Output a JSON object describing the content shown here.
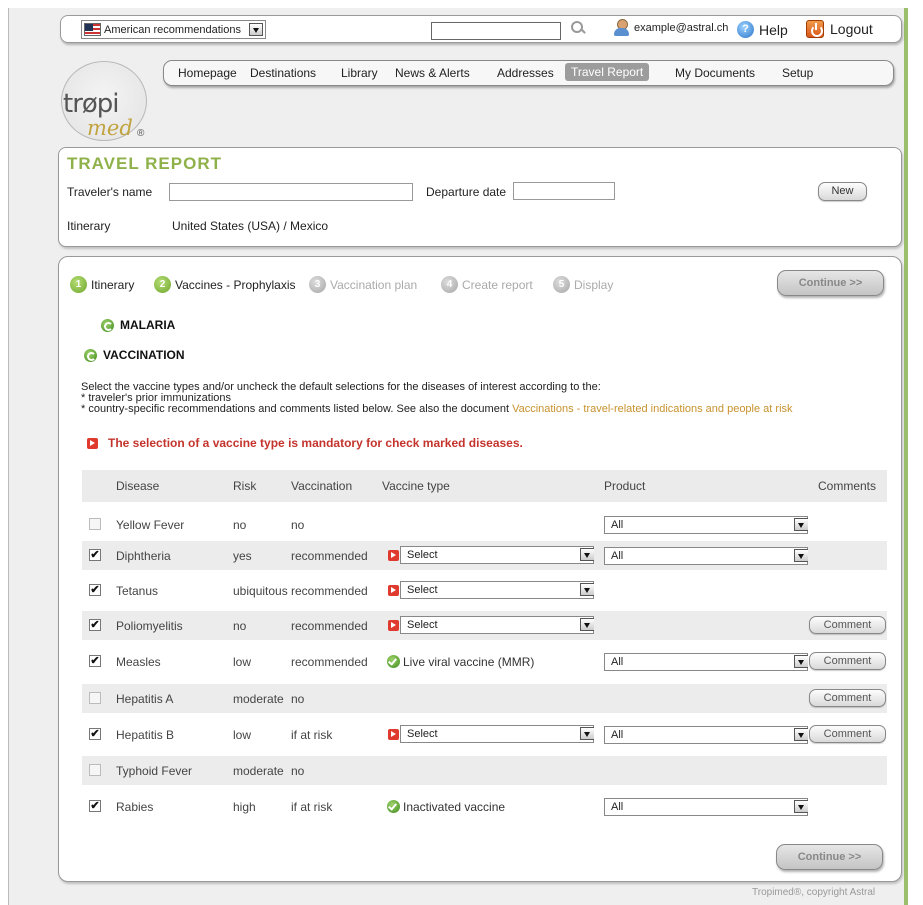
{
  "topbar": {
    "language": "American recommendations",
    "search_placeholder": "",
    "user_email": "example@astral.ch",
    "help_label": "Help",
    "logout_label": "Logout"
  },
  "nav": {
    "items": [
      "Homepage",
      "Destinations",
      "Library",
      "News & Alerts",
      "Addresses",
      "Travel Report",
      "My Documents",
      "Setup"
    ],
    "active": "Travel Report"
  },
  "logo": {
    "text1": "trøpi",
    "text2": "med",
    "reg": "®"
  },
  "travel_report": {
    "title": "TRAVEL REPORT",
    "traveler_label": "Traveler's name",
    "traveler_value": "",
    "departure_label": "Departure date",
    "departure_value": "",
    "new_button": "New",
    "itinerary_label": "Itinerary",
    "itinerary_value": "United States (USA) / Mexico"
  },
  "steps": [
    {
      "num": "1",
      "label": "Itinerary",
      "active": true
    },
    {
      "num": "2",
      "label": "Vaccines - Prophylaxis",
      "active": true
    },
    {
      "num": "3",
      "label": "Vaccination plan",
      "active": false
    },
    {
      "num": "4",
      "label": "Create report",
      "active": false
    },
    {
      "num": "5",
      "label": "Display",
      "active": false
    }
  ],
  "continue_label": "Continue >>",
  "sections": {
    "malaria": "MALARIA",
    "vaccination": "VACCINATION"
  },
  "intro": {
    "line1": "Select the vaccine types and/or uncheck the default selections for the diseases of interest according to the:",
    "line2": "* traveler's prior immunizations",
    "line3": "* country-specific recommendations and comments listed below. See also the document",
    "link": "Vaccinations - travel-related indications and people at risk"
  },
  "warning": "The selection of a vaccine type is mandatory for check marked diseases.",
  "table": {
    "headers": {
      "disease": "Disease",
      "risk": "Risk",
      "vaccination": "Vaccination",
      "vaccine_type": "Vaccine type",
      "product": "Product",
      "comments": "Comments"
    },
    "rows": [
      {
        "checked": false,
        "disabled": true,
        "disease": "Yellow Fever",
        "risk": "no",
        "vaccination": "no",
        "type_kind": "none",
        "vaccine_type": "",
        "product": "All",
        "comment": ""
      },
      {
        "checked": true,
        "disabled": false,
        "disease": "Diphtheria",
        "risk": "yes",
        "vaccination": "recommended",
        "type_kind": "select",
        "vaccine_type": "Select",
        "product": "All",
        "comment": ""
      },
      {
        "checked": true,
        "disabled": false,
        "disease": "Tetanus",
        "risk": "ubiquitous",
        "vaccination": "recommended",
        "type_kind": "select",
        "vaccine_type": "Select",
        "product": "",
        "comment": ""
      },
      {
        "checked": true,
        "disabled": false,
        "disease": "Poliomyelitis",
        "risk": "no",
        "vaccination": "recommended",
        "type_kind": "select",
        "vaccine_type": "Select",
        "product": "",
        "comment": "Comment"
      },
      {
        "checked": true,
        "disabled": false,
        "disease": "Measles",
        "risk": "low",
        "vaccination": "recommended",
        "type_kind": "fixed",
        "vaccine_type": "Live viral vaccine (MMR)",
        "product": "All",
        "comment": "Comment"
      },
      {
        "checked": false,
        "disabled": true,
        "disease": "Hepatitis A",
        "risk": "moderate",
        "vaccination": "no",
        "type_kind": "none",
        "vaccine_type": "",
        "product": "",
        "comment": "Comment"
      },
      {
        "checked": true,
        "disabled": false,
        "disease": "Hepatitis B",
        "risk": "low",
        "vaccination": "if at risk",
        "type_kind": "select",
        "vaccine_type": "Select",
        "product": "All",
        "comment": "Comment"
      },
      {
        "checked": false,
        "disabled": true,
        "disease": "Typhoid Fever",
        "risk": "moderate",
        "vaccination": "no",
        "type_kind": "none",
        "vaccine_type": "",
        "product": "",
        "comment": ""
      },
      {
        "checked": true,
        "disabled": false,
        "disease": "Rabies",
        "risk": "high",
        "vaccination": "if at risk",
        "type_kind": "fixed",
        "vaccine_type": "Inactivated vaccine",
        "product": "All",
        "comment": ""
      }
    ]
  },
  "footer": "Tropimed®, copyright Astral"
}
